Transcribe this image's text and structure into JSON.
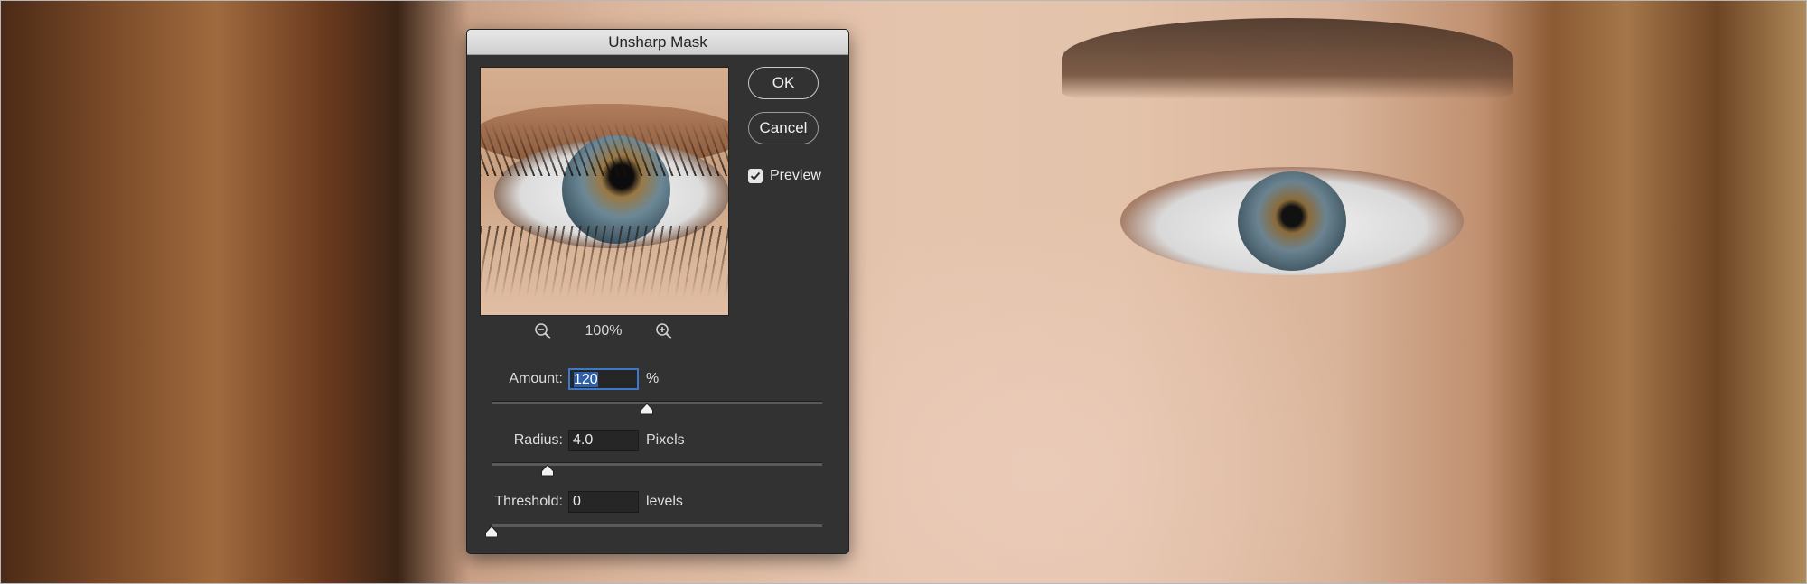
{
  "dialog": {
    "title": "Unsharp Mask",
    "ok_label": "OK",
    "cancel_label": "Cancel",
    "preview": {
      "label": "Preview",
      "checked": true
    },
    "zoom": {
      "level": "100%",
      "zoom_out_icon": "zoom-out-icon",
      "zoom_in_icon": "zoom-in-icon"
    },
    "amount": {
      "label": "Amount:",
      "value": "120",
      "unit": "%",
      "slider_fraction": 0.47
    },
    "radius": {
      "label": "Radius:",
      "value": "4.0",
      "unit": "Pixels",
      "slider_fraction": 0.17
    },
    "threshold": {
      "label": "Threshold:",
      "value": "0",
      "unit": "levels",
      "slider_fraction": 0.0
    }
  },
  "colors": {
    "dialog_bg": "#323232",
    "selection_blue": "#3d79c9"
  }
}
